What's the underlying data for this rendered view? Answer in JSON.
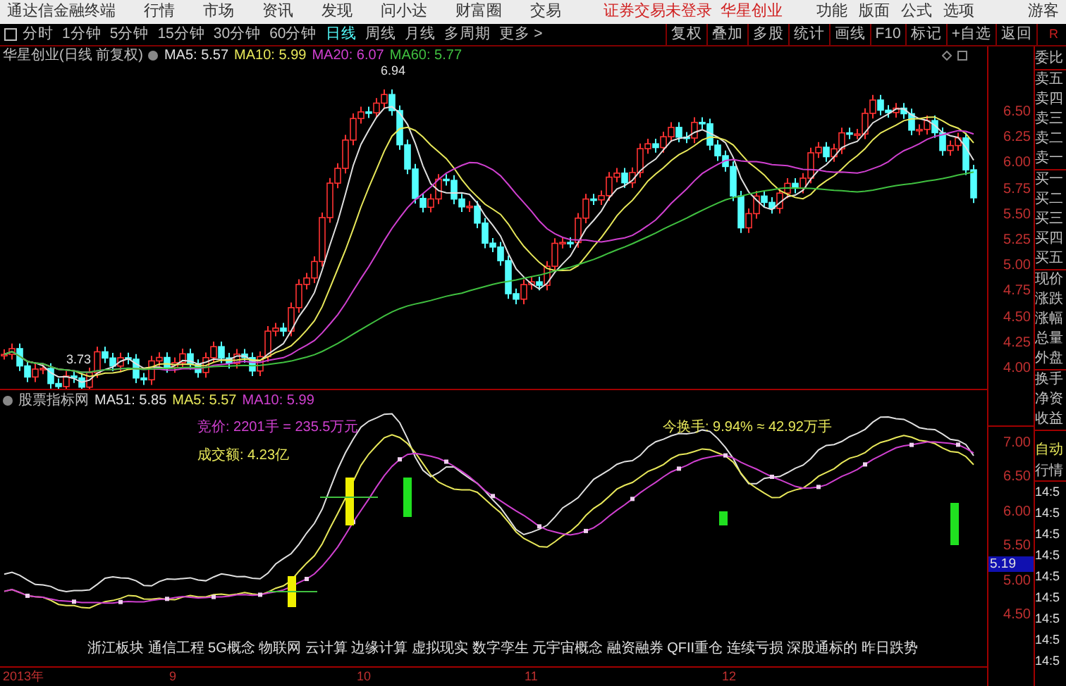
{
  "menubar": {
    "logo_text": "通达信金融终端",
    "items": [
      "行情",
      "市场",
      "资讯",
      "发现",
      "问小达",
      "财富圈",
      "交易"
    ],
    "notice": "证券交易未登录",
    "stock": "华星创业",
    "tools": [
      "功能",
      "版面",
      "公式",
      "选项"
    ],
    "user": "游客"
  },
  "toolbar": {
    "periods": [
      {
        "label": "分时",
        "selected": false
      },
      {
        "label": "1分钟",
        "selected": false
      },
      {
        "label": "5分钟",
        "selected": false
      },
      {
        "label": "15分钟",
        "selected": false
      },
      {
        "label": "30分钟",
        "selected": false
      },
      {
        "label": "60分钟",
        "selected": false
      },
      {
        "label": "日线",
        "selected": true
      },
      {
        "label": "周线",
        "selected": false
      },
      {
        "label": "月线",
        "selected": false
      },
      {
        "label": "多周期",
        "selected": false
      },
      {
        "label": "更多 >",
        "selected": false
      }
    ],
    "actions": [
      "复权",
      "叠加",
      "多股",
      "统计",
      "画线",
      "F10",
      "标记",
      "+自选",
      "返回"
    ],
    "corner": "R"
  },
  "main_chart": {
    "title": "华星创业(日线 前复权)",
    "indicators": [
      {
        "label": "MA5: 5.57",
        "color": "#e0e0e0"
      },
      {
        "label": "MA10: 5.99",
        "color": "#e8e85a"
      },
      {
        "label": "MA20: 6.07",
        "color": "#d040d0"
      },
      {
        "label": "MA60: 5.77",
        "color": "#40c040"
      }
    ],
    "high_label": "6.94",
    "low_label": "3.73",
    "axis": [
      "6.50",
      "6.25",
      "6.00",
      "5.75",
      "5.50",
      "5.25",
      "5.00",
      "4.75",
      "4.50",
      "4.25",
      "4.00"
    ]
  },
  "indicator_chart": {
    "title": "股票指标网",
    "indicators": [
      {
        "label": "MA51: 5.85",
        "color": "#e0e0e0"
      },
      {
        "label": "MA5: 5.57",
        "color": "#e8e85a"
      },
      {
        "label": "MA10: 5.99",
        "color": "#d040d0"
      }
    ],
    "notes": [
      {
        "text": "竞价: 2201手 = 235.5万元",
        "color": "#d040d0"
      },
      {
        "text": "成交额: 4.23亿",
        "color": "#e8e85a"
      },
      {
        "text": "今换手: 9.94% ≈ 42.92万手",
        "color": "#e8e85a"
      }
    ],
    "axis": [
      "7.00",
      "6.50",
      "6.00",
      "5.50",
      "5.00",
      "4.50"
    ],
    "current": "5.19"
  },
  "concepts": "浙江板块 通信工程 5G概念 物联网 云计算 边缘计算 虚拟现实 数字孪生 元宇宙概念 融资融券 QFII重仓 连续亏损 深股通标的 昨日跌势",
  "time_axis": [
    "2013年",
    "9",
    "10",
    "11",
    "12"
  ],
  "quote_panel": {
    "groups": [
      [
        "委比"
      ],
      [
        "卖五",
        "卖四",
        "卖三",
        "卖二",
        "卖一"
      ],
      [
        "买一",
        "买二",
        "买三",
        "买四",
        "买五"
      ],
      [
        "现价",
        "涨跌",
        "涨幅",
        "总量",
        "外盘"
      ],
      [
        "换手",
        "净资",
        "收益"
      ]
    ],
    "mode": "自动",
    "tab": "行情",
    "times": [
      "14:5",
      "14:5",
      "14:5",
      "14:5",
      "14:5",
      "14:5",
      "14:5",
      "14:5",
      "14:5"
    ]
  }
}
